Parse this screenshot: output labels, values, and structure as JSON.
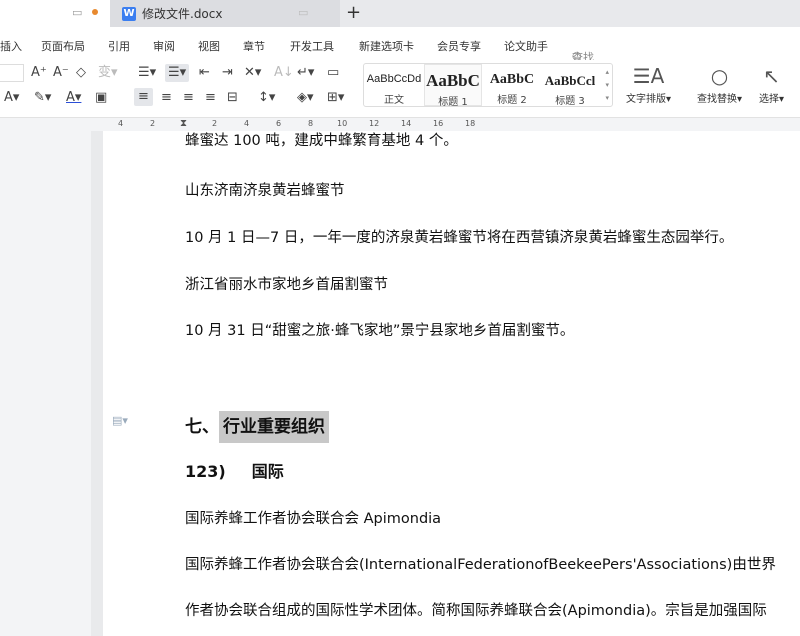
{
  "tabs": {
    "doc_title": "修改文件.docx",
    "new_tab": "+"
  },
  "menu": [
    "插入",
    "页面布局",
    "引用",
    "审阅",
    "视图",
    "章节",
    "开发工具",
    "新建选项卡",
    "会员专享",
    "论文助手"
  ],
  "search_placeholder": "查找命令、搜索模板",
  "styles": [
    {
      "preview": "AaBbCcDd",
      "label": "正文"
    },
    {
      "preview": "AaBbC",
      "label": "标题 1"
    },
    {
      "preview": "AaBbC",
      "label": "标题 2"
    },
    {
      "preview": "AaBbCcl",
      "label": "标题 3"
    }
  ],
  "tools": {
    "text_layout": "文字排版",
    "find_replace": "查找替换",
    "select": "选择"
  },
  "ruler": [
    "4",
    "2",
    "2",
    "4",
    "6",
    "8",
    "10",
    "12",
    "14",
    "16",
    "18"
  ],
  "doc": {
    "p0": "蜂蜜达 100 吨，建成中蜂繁育基地 4 个。",
    "p1": "山东济南济泉黄岩蜂蜜节",
    "p2": "10 月 1 日—7 日，一年一度的济泉黄岩蜂蜜节将在西营镇济泉黄岩蜂蜜生态园举行。",
    "p3": "浙江省丽水市家地乡首届割蜜节",
    "p4": "10 月 31 日“甜蜜之旅·蜂飞家地”景宁县家地乡首届割蜜节。",
    "h1_prefix": "七、",
    "h1_sel": "行业重要组织",
    "h2_num": "123)",
    "h2_text": "国际",
    "p5": "国际养蜂工作者协会联合会 Apimondia",
    "p6": "国际养蜂工作者协会联合会(InternationalFederationofBeekeePers'Associations)由世界",
    "p7": "作者协会联合组成的国际性学术团体。简称国际养蜂联合会(Apimondia)。宗旨是加强国际"
  }
}
